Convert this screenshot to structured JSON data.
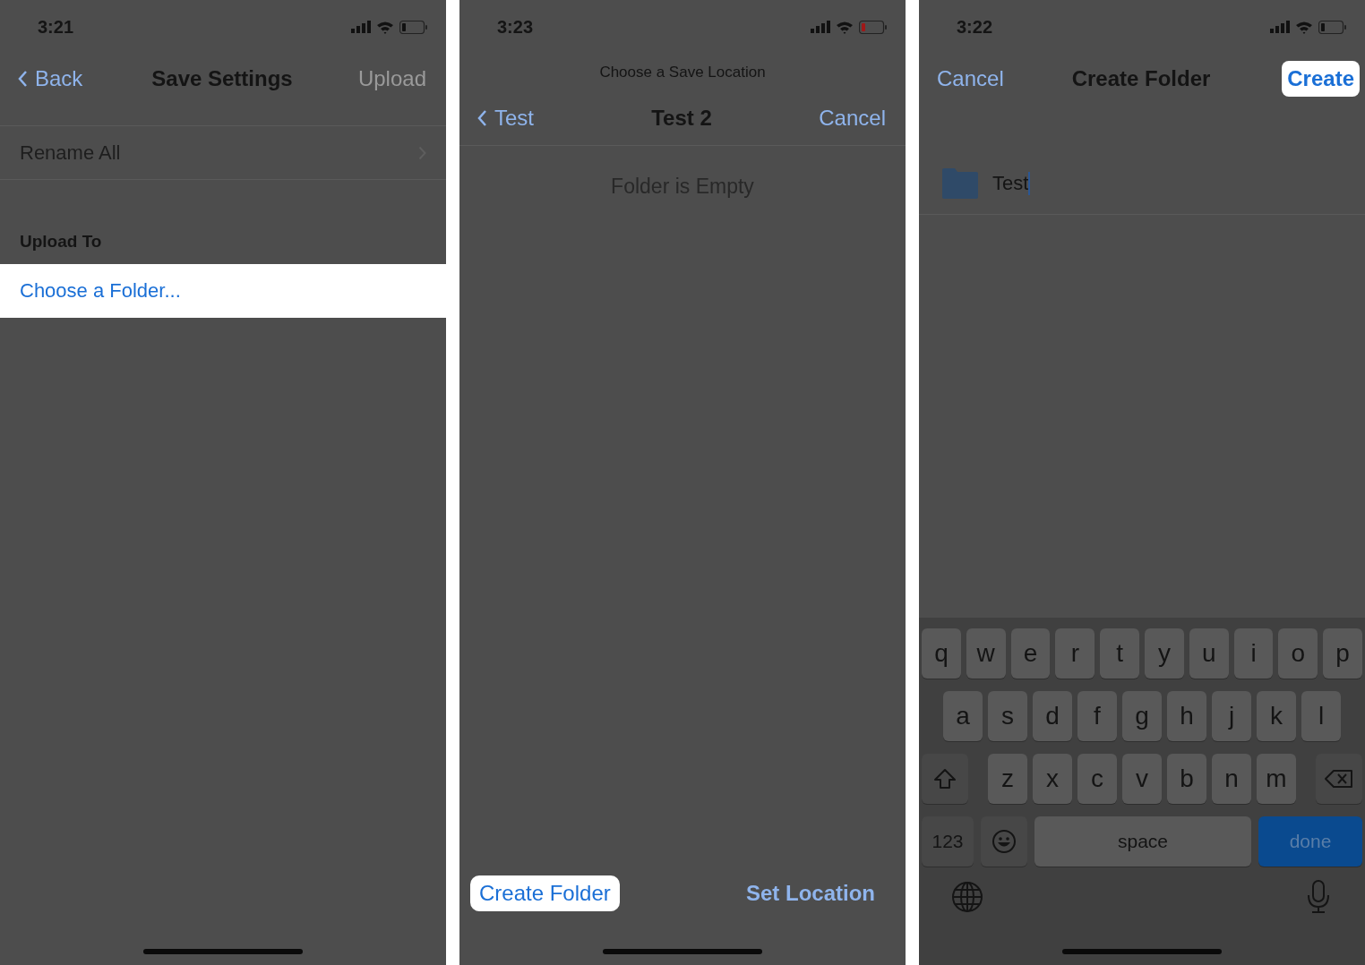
{
  "screens": [
    {
      "kind": "settings",
      "time": "3:21",
      "battery_low": false,
      "nav": {
        "back": "Back",
        "title": "Save Settings",
        "action": "Upload",
        "action_disabled": true
      },
      "rows": [
        {
          "label": "Rename All"
        }
      ],
      "section_header": "Upload To",
      "choose": {
        "label": "Choose a Folder...",
        "highlighted": true
      }
    },
    {
      "kind": "location",
      "time": "3:23",
      "battery_low": true,
      "prompt": "Choose a Save Location",
      "nav": {
        "back": "Test",
        "title": "Test 2",
        "action": "Cancel",
        "action_disabled": false
      },
      "empty_text": "Folder is Empty",
      "toolbar": [
        {
          "label": "Create Folder",
          "highlighted": true,
          "bold": false
        },
        {
          "label": "Set Location",
          "highlighted": false,
          "bold": true
        }
      ]
    },
    {
      "kind": "create",
      "time": "3:22",
      "battery_low": false,
      "nav": {
        "cancel": "Cancel",
        "title": "Create Folder",
        "action": "Create",
        "highlighted": true
      },
      "field": {
        "value": "Test"
      },
      "keyboard": [
        [
          {
            "kind": "char",
            "label": "q"
          },
          {
            "kind": "char",
            "label": "w"
          },
          {
            "kind": "char",
            "label": "e"
          },
          {
            "kind": "char",
            "label": "r"
          },
          {
            "kind": "char",
            "label": "t"
          },
          {
            "kind": "char",
            "label": "y"
          },
          {
            "kind": "char",
            "label": "u"
          },
          {
            "kind": "char",
            "label": "i"
          },
          {
            "kind": "char",
            "label": "o"
          },
          {
            "kind": "char",
            "label": "p"
          }
        ],
        [
          {
            "kind": "char",
            "label": "a"
          },
          {
            "kind": "char",
            "label": "s"
          },
          {
            "kind": "char",
            "label": "d"
          },
          {
            "kind": "char",
            "label": "f"
          },
          {
            "kind": "char",
            "label": "g"
          },
          {
            "kind": "char",
            "label": "h"
          },
          {
            "kind": "char",
            "label": "j"
          },
          {
            "kind": "char",
            "label": "k"
          },
          {
            "kind": "char",
            "label": "l"
          }
        ],
        [
          {
            "kind": "shift"
          },
          {
            "kind": "char",
            "label": "z"
          },
          {
            "kind": "char",
            "label": "x"
          },
          {
            "kind": "char",
            "label": "c"
          },
          {
            "kind": "char",
            "label": "v"
          },
          {
            "kind": "char",
            "label": "b"
          },
          {
            "kind": "char",
            "label": "n"
          },
          {
            "kind": "char",
            "label": "m"
          },
          {
            "kind": "delete"
          }
        ],
        [
          {
            "kind": "mode",
            "label": "123"
          },
          {
            "kind": "emoji"
          },
          {
            "kind": "space",
            "label": "space"
          },
          {
            "kind": "return",
            "label": "done"
          }
        ]
      ]
    }
  ]
}
